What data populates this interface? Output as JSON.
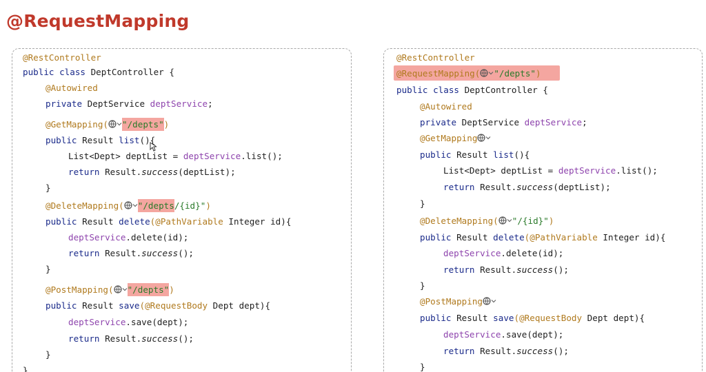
{
  "slide": {
    "title": "@RequestMapping"
  },
  "left": {
    "l1": "@RestController",
    "l2_kw": "public class",
    "l2_name": " DeptController {",
    "l3": "@Autowired",
    "l4_kw": "private",
    "l4_type": " DeptService ",
    "l4_field": "deptService",
    "l4_end": ";",
    "l5_ann": "@GetMapping(",
    "l5_path": "\"/depts\"",
    "l5_end": ")",
    "l6_kw": "public",
    "l6_rest": " Result ",
    "l6_name": "list",
    "l6_end": "(){",
    "l7_pre": "List<Dept> deptList = ",
    "l7_field": "deptService",
    "l7_end": ".list();",
    "l8_kw": "return",
    "l8_mid": " Result.",
    "l8_it": "success",
    "l8_end": "(deptList);",
    "l9": "}",
    "l10_ann": "@DeleteMapping(",
    "l10_path": "\"/depts",
    "l10_rest": "/{id}\"",
    "l10_end": ")",
    "l11_kw": "public",
    "l11_rest": " Result ",
    "l11_name": "delete",
    "l11_ann": "(@PathVariable",
    "l11_end": " Integer id){",
    "l12_field": "deptService",
    "l12_end": ".delete(id);",
    "l13_kw": "return",
    "l13_mid": " Result.",
    "l13_it": "success",
    "l13_end": "();",
    "l14": "}",
    "l15_ann": "@PostMapping(",
    "l15_path": "\"/depts\"",
    "l15_end": ")",
    "l16_kw": "public",
    "l16_rest": " Result ",
    "l16_name": "save",
    "l16_ann": "(@RequestBody",
    "l16_end": " Dept dept){",
    "l17_field": "deptService",
    "l17_end": ".save(dept);",
    "l18_kw": "return",
    "l18_mid": " Result.",
    "l18_it": "success",
    "l18_end": "();",
    "l19": "}",
    "l20": "}"
  },
  "right": {
    "r1": "@RestController",
    "r2_ann": "@RequestMapping(",
    "r2_path": "\"/depts\"",
    "r2_end": ")",
    "r3_kw": "public class",
    "r3_name": " DeptController {",
    "r4": "@Autowired",
    "r5_kw": "private",
    "r5_type": " DeptService ",
    "r5_field": "deptService",
    "r5_end": ";",
    "r6_ann": "@GetMapping",
    "r7_kw": "public",
    "r7_rest": " Result ",
    "r7_name": "list",
    "r7_end": "(){",
    "r8_pre": "List<Dept> deptList = ",
    "r8_field": "deptService",
    "r8_end": ".list();",
    "r9_kw": "return",
    "r9_mid": " Result.",
    "r9_it": "success",
    "r9_end": "(deptList);",
    "r10": "}",
    "r11_ann": "@DeleteMapping(",
    "r11_path": "\"/{id}\"",
    "r11_end": ")",
    "r12_kw": "public",
    "r12_rest": " Result ",
    "r12_name": "delete",
    "r12_ann": "(@PathVariable",
    "r12_end": " Integer id){",
    "r13_field": "deptService",
    "r13_end": ".delete(id);",
    "r14_kw": "return",
    "r14_mid": " Result.",
    "r14_it": "success",
    "r14_end": "();",
    "r15": "}",
    "r16_ann": "@PostMapping",
    "r17_kw": "public",
    "r17_rest": " Result ",
    "r17_name": "save",
    "r17_ann": "(@RequestBody",
    "r17_end": " Dept dept){",
    "r18_field": "deptService",
    "r18_end": ".save(dept);",
    "r19_kw": "return",
    "r19_mid": " Result.",
    "r19_it": "success",
    "r19_end": "();",
    "r20": "}"
  },
  "icons": {
    "endpoint": "globe-icon",
    "dropdown": "chevron-down-icon"
  },
  "colors": {
    "title": "#c0392b",
    "highlight": "#f4a6a0",
    "annotation": "#b07a1e",
    "keyword": "#1a2a8a",
    "field": "#8e44ad"
  }
}
